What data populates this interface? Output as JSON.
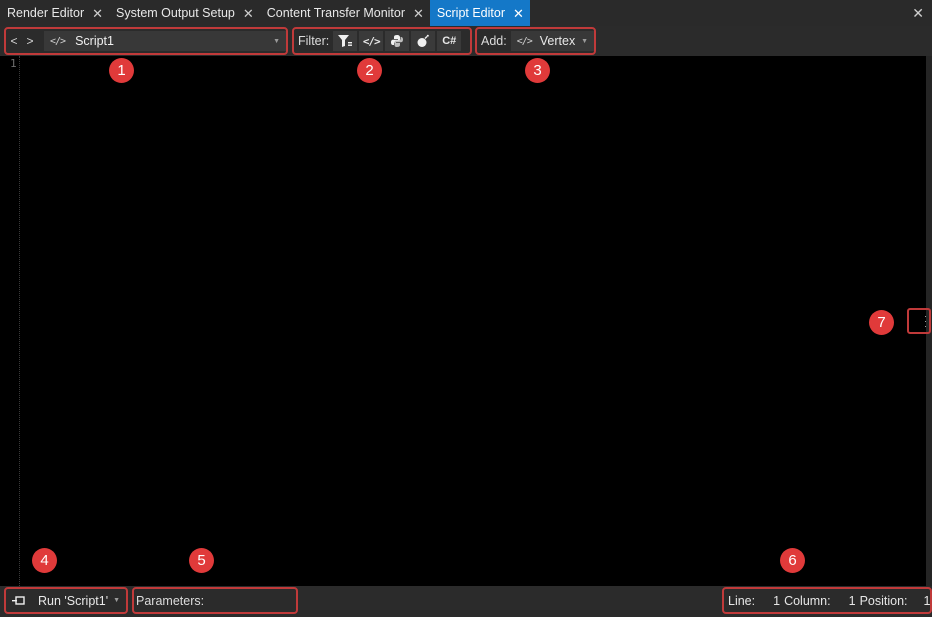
{
  "tabs": [
    {
      "label": "Render Editor",
      "active": false
    },
    {
      "label": "System Output Setup",
      "active": false
    },
    {
      "label": "Content Transfer Monitor",
      "active": false
    },
    {
      "label": "Script Editor",
      "active": true
    }
  ],
  "window": {
    "close_glyph": "✕"
  },
  "toolbar": {
    "back": "<",
    "forward": ">",
    "code_icon": "</>",
    "script_name": "Script1",
    "filter_label": "Filter:",
    "filter_buttons": [
      {
        "icon": "filter-icon",
        "text": ""
      },
      {
        "icon": "code-icon",
        "text": "</>"
      },
      {
        "icon": "python-icon",
        "text": ""
      },
      {
        "icon": "bomb-icon",
        "text": ""
      },
      {
        "icon": "csharp-icon",
        "text": "C#"
      }
    ],
    "add_label": "Add:",
    "add_value": "Vertex"
  },
  "editor": {
    "line_numbers": [
      "1"
    ],
    "content": ""
  },
  "statusbar": {
    "run_label": "Run 'Script1'",
    "parameters_label": "Parameters:",
    "line_label": "Line:",
    "line_value": "1",
    "column_label": "Column:",
    "column_value": "1",
    "position_label": "Position:",
    "position_value": "1"
  },
  "markers": [
    "1",
    "2",
    "3",
    "4",
    "5",
    "6",
    "7"
  ],
  "colors": {
    "accent": "#1478c8",
    "highlight": "#c03a3a",
    "marker": "#e03a3a"
  }
}
